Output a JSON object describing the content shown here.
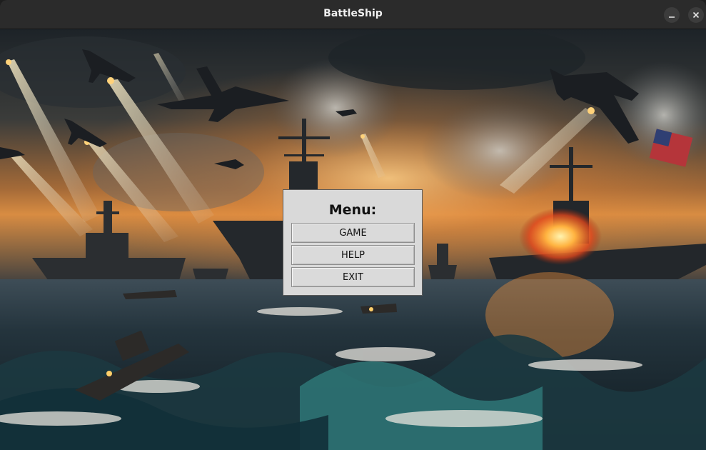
{
  "window": {
    "title": "BattleShip",
    "controls": {
      "minimize_icon": "minimize-icon",
      "close_icon": "close-icon"
    }
  },
  "menu": {
    "title": "Menu:",
    "buttons": [
      {
        "label": "GAME"
      },
      {
        "label": "HELP"
      },
      {
        "label": "EXIT"
      }
    ]
  },
  "background": {
    "scene": "naval-battle-artwork"
  }
}
